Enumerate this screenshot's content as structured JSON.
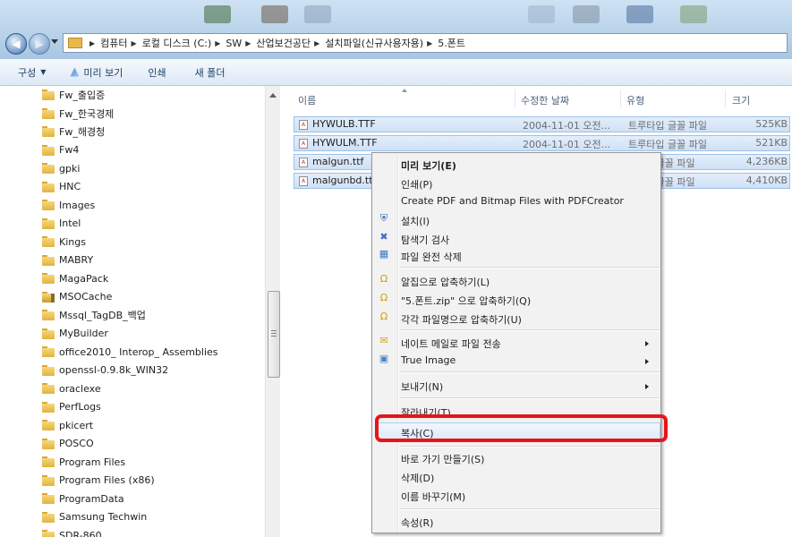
{
  "address": {
    "breadcrumb": [
      "컴퓨터",
      "로컬 디스크 (C:)",
      "SW",
      "산업보건공단",
      "설치파일(신규사용자용)",
      "5.폰트"
    ]
  },
  "toolbar": {
    "organize_label": "구성",
    "preview_label": "미리 보기",
    "print_label": "인쇄",
    "new_folder_label": "새 폴더"
  },
  "tree": {
    "items": [
      {
        "label": "Fw_출입증",
        "icon": "folder-icon"
      },
      {
        "label": "Fw_한국경제",
        "icon": "folder-icon"
      },
      {
        "label": "Fw_해경청",
        "icon": "folder-icon"
      },
      {
        "label": "Fw4",
        "icon": "folder-icon"
      },
      {
        "label": "gpki",
        "icon": "folder-icon"
      },
      {
        "label": "HNC",
        "icon": "folder-icon"
      },
      {
        "label": "Images",
        "icon": "folder-icon"
      },
      {
        "label": "Intel",
        "icon": "folder-icon"
      },
      {
        "label": "Kings",
        "icon": "folder-icon"
      },
      {
        "label": "MABRY",
        "icon": "folder-icon"
      },
      {
        "label": "MagaPack",
        "icon": "folder-icon"
      },
      {
        "label": "MSOCache",
        "icon": "locked-folder-icon"
      },
      {
        "label": "Mssql_TagDB_백업",
        "icon": "folder-icon"
      },
      {
        "label": "MyBuilder",
        "icon": "folder-icon"
      },
      {
        "label": "office2010_ Interop_ Assemblies",
        "icon": "folder-icon"
      },
      {
        "label": "openssl-0.9.8k_WIN32",
        "icon": "folder-icon"
      },
      {
        "label": "oraclexe",
        "icon": "folder-icon"
      },
      {
        "label": "PerfLogs",
        "icon": "folder-icon"
      },
      {
        "label": "pkicert",
        "icon": "folder-icon"
      },
      {
        "label": "POSCO",
        "icon": "folder-icon"
      },
      {
        "label": "Program Files",
        "icon": "folder-icon"
      },
      {
        "label": "Program Files (x86)",
        "icon": "folder-icon"
      },
      {
        "label": "ProgramData",
        "icon": "folder-icon"
      },
      {
        "label": "Samsung Techwin",
        "icon": "folder-icon"
      },
      {
        "label": "SDR-860",
        "icon": "folder-icon"
      }
    ]
  },
  "filelist": {
    "columns": {
      "name": "이름",
      "modified": "수정한 날짜",
      "type": "유형",
      "size": "크기"
    },
    "files": [
      {
        "name": "HYWULB.TTF",
        "modified": "2004-11-01 오전...",
        "type": "트루타입 글꼴 파일",
        "size": "525KB"
      },
      {
        "name": "HYWULM.TTF",
        "modified": "2004-11-01 오전...",
        "type": "트루타입 글꼴 파일",
        "size": "521KB"
      },
      {
        "name": "malgun.ttf",
        "modified": "",
        "type": "입 글꼴 파일",
        "size": "4,236KB"
      },
      {
        "name": "malgunbd.tt",
        "modified": "",
        "type": "입 글꼴 파일",
        "size": "4,410KB"
      }
    ]
  },
  "context_menu": {
    "preview": "미리 보기(E)",
    "print": "인쇄(P)",
    "pdfcreator": "Create PDF and Bitmap Files with PDFCreator",
    "install": "설치(I)",
    "explorer_scan": "탐색기 검사",
    "secure_delete": "파일 완전 삭제",
    "alzip_compress": "알집으로 압축하기(L)",
    "alzip_compress_to": "\"5.폰트.zip\" 으로 압축하기(Q)",
    "alzip_each": "각각 파일명으로 압축하기(U)",
    "nate_send": "네이트 메일로 파일 전송",
    "true_image": "True Image",
    "send_to": "보내기(N)",
    "cut": "잘라내기(T)",
    "copy": "복사(C)",
    "shortcut": "바로 가기 만들기(S)",
    "delete": "삭제(D)",
    "rename": "이름 바꾸기(M)",
    "properties": "속성(R)"
  },
  "colors": {
    "selection_fill": "#cfe1f6",
    "highlight_annotation": "#e8141a"
  }
}
